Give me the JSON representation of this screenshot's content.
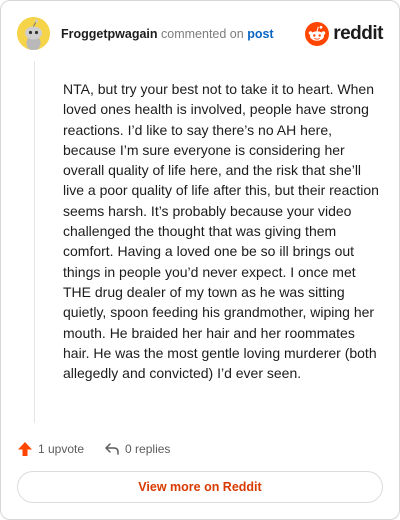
{
  "comment": {
    "username": "Froggetpwagain",
    "verb": "commented on",
    "post_link": "post",
    "body": "NTA, but try your best not to take it to heart. When loved ones health is involved, people have strong reactions. I’d like to say there’s no AH here, because I’m sure everyone is considering her overall quality of life here, and the risk that she’ll live a poor quality of life after this, but their reaction seems harsh. It’s probably because your video challenged the thought that was giving them comfort. Having a loved one be so ill brings out things in people you’d never expect. I once met THE drug dealer of my town as he was sitting quietly, spoon feeding his grandmother, wiping her mouth. He braided her hair and her roommates hair. He was the most gentle loving murderer (both allegedly and convicted) I’d ever seen."
  },
  "brand": {
    "name": "reddit",
    "icon": "reddit-logo-icon",
    "color": "#ff4500"
  },
  "actions": {
    "upvotes": "1 upvote",
    "replies": "0 replies"
  },
  "footer": {
    "view_more_label": "View more on Reddit"
  },
  "colors": {
    "accent": "#d93a00",
    "upvote": "#ff4500",
    "link": "#0a66c2",
    "avatar_bg": "#f6d44a"
  }
}
